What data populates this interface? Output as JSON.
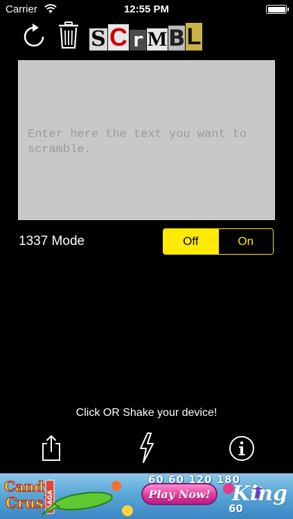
{
  "status_bar": {
    "carrier": "Carrier",
    "time": "12:55 PM",
    "battery_level": 1.0,
    "wifi_icon": "wifi-icon",
    "battery_icon": "battery-icon"
  },
  "toolbar": {
    "refresh_icon": "refresh-icon",
    "trash_icon": "trash-icon"
  },
  "logo": {
    "letters": [
      {
        "char": "S",
        "bg": "#d9d9d9",
        "fg": "#000000"
      },
      {
        "char": "C",
        "bg": "#e8e8e8",
        "fg": "#d00000"
      },
      {
        "char": "r",
        "bg": "#4a4a4a",
        "fg": "#ffffff"
      },
      {
        "char": "M",
        "bg": "#e6e6e6",
        "fg": "#000000"
      },
      {
        "char": "B",
        "bg": "#bdbdbd",
        "fg": "#222222"
      },
      {
        "char": "L",
        "bg": "#c9b24a",
        "fg": "#111111"
      }
    ]
  },
  "input": {
    "placeholder": "Enter here the text you want to scramble.",
    "value": ""
  },
  "mode": {
    "label": "1337 Mode",
    "off_label": "Off",
    "on_label": "On",
    "selected": "Off",
    "accent": "#ffeb00"
  },
  "hint": "Click OR Shake your device!",
  "bottom_bar": {
    "share_icon": "share-icon",
    "flash_icon": "lightning-icon",
    "info_icon": "info-icon"
  },
  "ad": {
    "title_line1": "Candy",
    "title_line2": "Crush",
    "subtitle": "SAGA",
    "numbers_top": "60 60 120 180",
    "numbers_bottom": "60",
    "button_label": "Play Now!",
    "brand": "King"
  }
}
